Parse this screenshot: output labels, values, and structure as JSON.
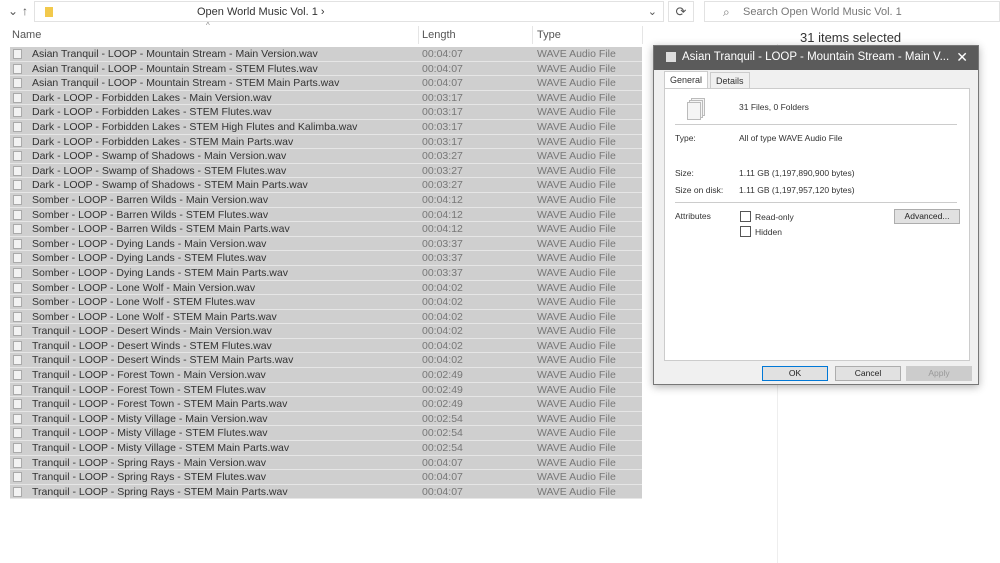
{
  "address": {
    "path": "Open World Music Vol. 1",
    "chevron": "›",
    "search_placeholder": "Search Open World Music Vol. 1",
    "refresh": "⟳",
    "up": "↑",
    "back": "⌄",
    "dropdown": "⌄"
  },
  "columns": {
    "name": "Name",
    "length": "Length",
    "type": "Type",
    "sort": "^"
  },
  "selection": "31 items selected",
  "files": [
    [
      "Asian Tranquil - LOOP - Mountain Stream - Main Version.wav",
      "00:04:07"
    ],
    [
      "Asian Tranquil - LOOP - Mountain Stream - STEM Flutes.wav",
      "00:04:07"
    ],
    [
      "Asian Tranquil - LOOP - Mountain Stream - STEM Main Parts.wav",
      "00:04:07"
    ],
    [
      "Dark - LOOP - Forbidden Lakes - Main Version.wav",
      "00:03:17"
    ],
    [
      "Dark - LOOP - Forbidden Lakes - STEM Flutes.wav",
      "00:03:17"
    ],
    [
      "Dark - LOOP - Forbidden Lakes - STEM High Flutes and Kalimba.wav",
      "00:03:17"
    ],
    [
      "Dark - LOOP - Forbidden Lakes - STEM Main Parts.wav",
      "00:03:17"
    ],
    [
      "Dark - LOOP - Swamp of Shadows - Main Version.wav",
      "00:03:27"
    ],
    [
      "Dark - LOOP - Swamp of Shadows - STEM Flutes.wav",
      "00:03:27"
    ],
    [
      "Dark - LOOP - Swamp of Shadows - STEM Main Parts.wav",
      "00:03:27"
    ],
    [
      "Somber - LOOP - Barren Wilds - Main Version.wav",
      "00:04:12"
    ],
    [
      "Somber - LOOP - Barren Wilds - STEM Flutes.wav",
      "00:04:12"
    ],
    [
      "Somber - LOOP - Barren Wilds - STEM Main Parts.wav",
      "00:04:12"
    ],
    [
      "Somber - LOOP - Dying Lands - Main Version.wav",
      "00:03:37"
    ],
    [
      "Somber - LOOP - Dying Lands - STEM Flutes.wav",
      "00:03:37"
    ],
    [
      "Somber - LOOP - Dying Lands - STEM Main Parts.wav",
      "00:03:37"
    ],
    [
      "Somber - LOOP - Lone Wolf - Main Version.wav",
      "00:04:02"
    ],
    [
      "Somber - LOOP - Lone Wolf - STEM Flutes.wav",
      "00:04:02"
    ],
    [
      "Somber - LOOP - Lone Wolf - STEM Main Parts.wav",
      "00:04:02"
    ],
    [
      "Tranquil - LOOP - Desert Winds - Main Version.wav",
      "00:04:02"
    ],
    [
      "Tranquil - LOOP - Desert Winds - STEM Flutes.wav",
      "00:04:02"
    ],
    [
      "Tranquil - LOOP - Desert Winds - STEM Main Parts.wav",
      "00:04:02"
    ],
    [
      "Tranquil - LOOP - Forest Town - Main Version.wav",
      "00:02:49"
    ],
    [
      "Tranquil - LOOP - Forest Town - STEM Flutes.wav",
      "00:02:49"
    ],
    [
      "Tranquil - LOOP - Forest Town - STEM Main Parts.wav",
      "00:02:49"
    ],
    [
      "Tranquil - LOOP - Misty Village - Main Version.wav",
      "00:02:54"
    ],
    [
      "Tranquil - LOOP - Misty Village - STEM Flutes.wav",
      "00:02:54"
    ],
    [
      "Tranquil - LOOP - Misty Village - STEM Main Parts.wav",
      "00:02:54"
    ],
    [
      "Tranquil - LOOP - Spring Rays - Main Version.wav",
      "00:04:07"
    ],
    [
      "Tranquil - LOOP - Spring Rays - STEM Flutes.wav",
      "00:04:07"
    ],
    [
      "Tranquil - LOOP - Spring Rays - STEM Main Parts.wav",
      "00:04:07"
    ]
  ],
  "file_type": "WAVE Audio File",
  "dialog": {
    "title": "Asian Tranquil - LOOP - Mountain Stream - Main V...",
    "close": "✕",
    "tabs": [
      "General",
      "Details"
    ],
    "summary": "31 Files, 0 Folders",
    "type_label": "Type:",
    "type_value": "All of type WAVE Audio File",
    "size_label": "Size:",
    "size_value": "1.11 GB (1,197,890,900 bytes)",
    "disk_label": "Size on disk:",
    "disk_value": "1.11 GB (1,197,957,120 bytes)",
    "attributes_label": "Attributes",
    "readonly": "Read-only",
    "hidden": "Hidden",
    "advanced": "Advanced...",
    "ok": "OK",
    "cancel": "Cancel",
    "apply": "Apply"
  }
}
